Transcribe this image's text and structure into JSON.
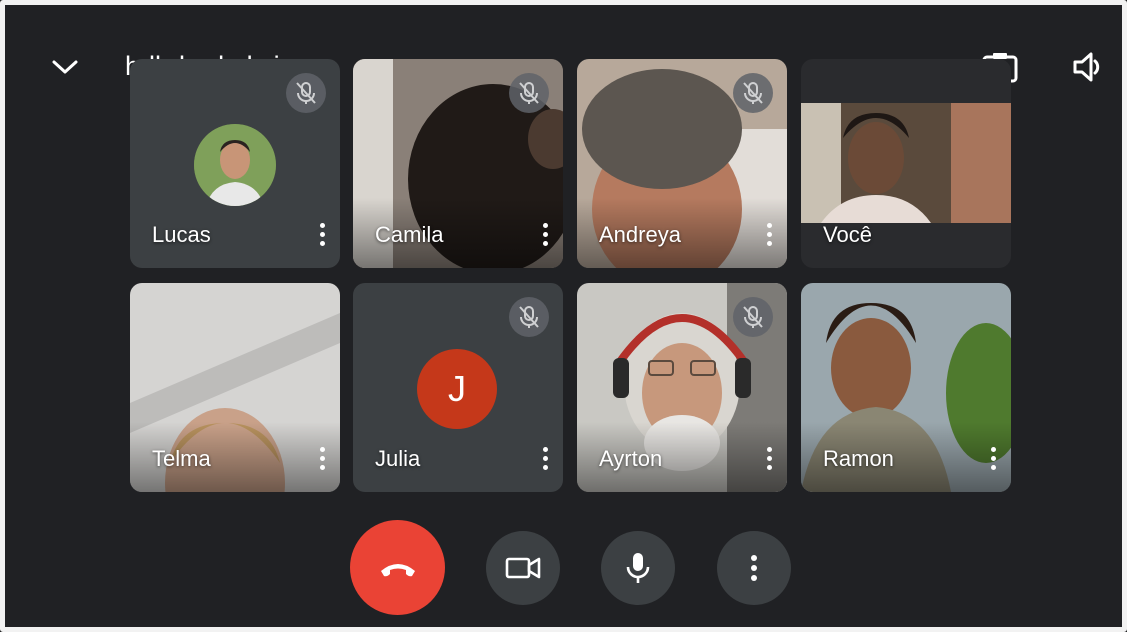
{
  "header": {
    "meeting_code": "hdb-buds-kxi",
    "collapse_icon": "chevron-down-icon",
    "details_icon": "caret-right-icon",
    "switch_camera_icon": "camera-switch-icon",
    "speaker_icon": "volume-icon"
  },
  "participants": [
    {
      "name": "Lucas",
      "muted": true
    },
    {
      "name": "Camila",
      "muted": true
    },
    {
      "name": "Andreya",
      "muted": true
    },
    {
      "name": "Você",
      "muted": false
    },
    {
      "name": "Telma",
      "muted": false
    },
    {
      "name": "Julia",
      "muted": true,
      "avatar_letter": "J",
      "avatar_color": "#c5381a"
    },
    {
      "name": "Ayrton",
      "muted": true
    },
    {
      "name": "Ramon",
      "muted": false
    }
  ],
  "controls": [
    {
      "name": "end-call",
      "icon": "phone-hangup-icon",
      "color": "#ea4335"
    },
    {
      "name": "camera",
      "icon": "video-camera-icon"
    },
    {
      "name": "microphone",
      "icon": "microphone-icon"
    },
    {
      "name": "more-options",
      "icon": "more-vert-icon"
    }
  ],
  "colors": {
    "background": "#202124",
    "tile": "#3c4043",
    "hangup": "#ea4335"
  }
}
